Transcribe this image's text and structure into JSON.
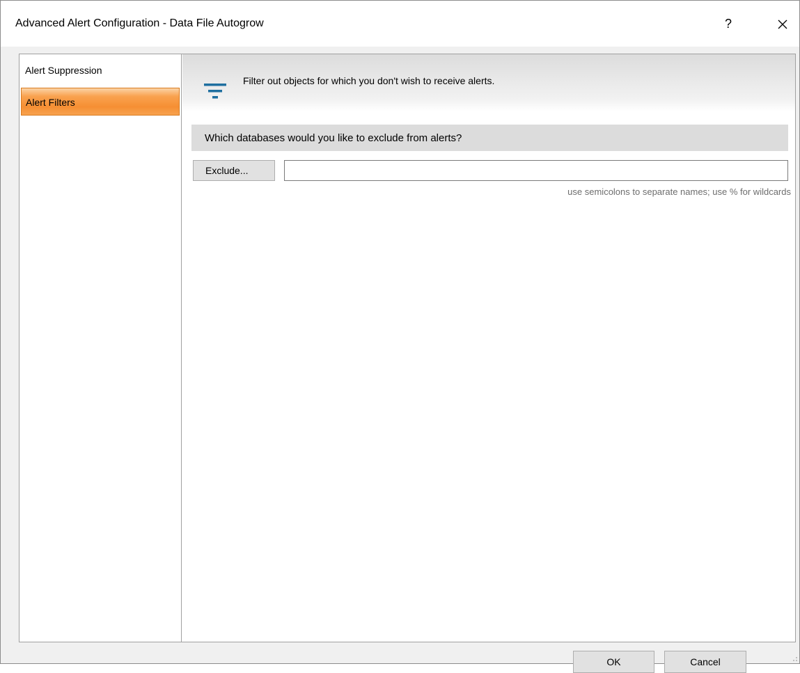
{
  "window": {
    "title": "Advanced Alert Configuration - Data File Autogrow",
    "help_label": "?"
  },
  "nav": {
    "items": [
      {
        "label": "Alert Suppression",
        "selected": false
      },
      {
        "label": "Alert Filters",
        "selected": true
      }
    ],
    "selected_color": "#f68f33"
  },
  "main": {
    "header_icon": "filter-icon",
    "header_text": "Filter out objects for which you don't wish to receive alerts.",
    "question": "Which databases would you like to exclude from alerts?",
    "exclude_button_label": "Exclude...",
    "exclude_input_value": "",
    "hint": "use semicolons to separate names; use % for wildcards"
  },
  "footer": {
    "ok_label": "OK",
    "cancel_label": "Cancel"
  },
  "colors": {
    "accent_icon": "#1f6fa0"
  }
}
